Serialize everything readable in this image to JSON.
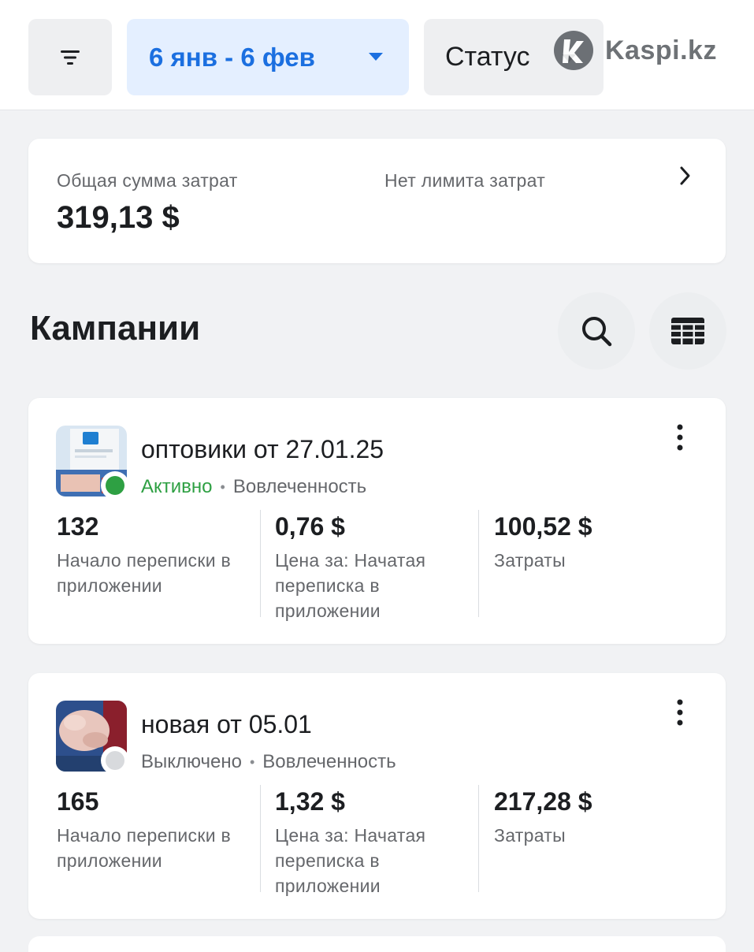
{
  "filters": {
    "filter_icon": "filter-lines-icon",
    "date_range": "6 янв - 6 фев",
    "status_label": "Статус"
  },
  "watermark": {
    "text": "Kaspi.kz"
  },
  "spend": {
    "total_label": "Общая сумма затрат",
    "total_value": "319,13 $",
    "limit_label": "Нет лимита затрат"
  },
  "campaigns_section": {
    "title": "Кампании",
    "search_icon": "search-icon",
    "table_icon": "table-icon"
  },
  "campaigns": [
    {
      "name": "оптовики от 27.01.25",
      "state": "Активно",
      "state_color": "#2ea043",
      "objective": "Вовлеченность",
      "metrics": [
        {
          "value": "132",
          "label": "Начало переписки в приложении"
        },
        {
          "value": "0,76 $",
          "label": "Цена за: Начатая переписка в приложении"
        },
        {
          "value": "100,52 $",
          "label": "Затраты"
        }
      ]
    },
    {
      "name": "новая от 05.01",
      "state": "Выключено",
      "state_color": "#d8dadd",
      "objective": "Вовлеченность",
      "metrics": [
        {
          "value": "165",
          "label": "Начало переписки в приложении"
        },
        {
          "value": "1,32 $",
          "label": "Цена за: Начатая переписка в приложении"
        },
        {
          "value": "217,28 $",
          "label": "Затраты"
        }
      ]
    }
  ],
  "colors": {
    "accent_blue": "#1b6fe0",
    "active_green": "#2ea043",
    "muted_text": "#65676b"
  }
}
